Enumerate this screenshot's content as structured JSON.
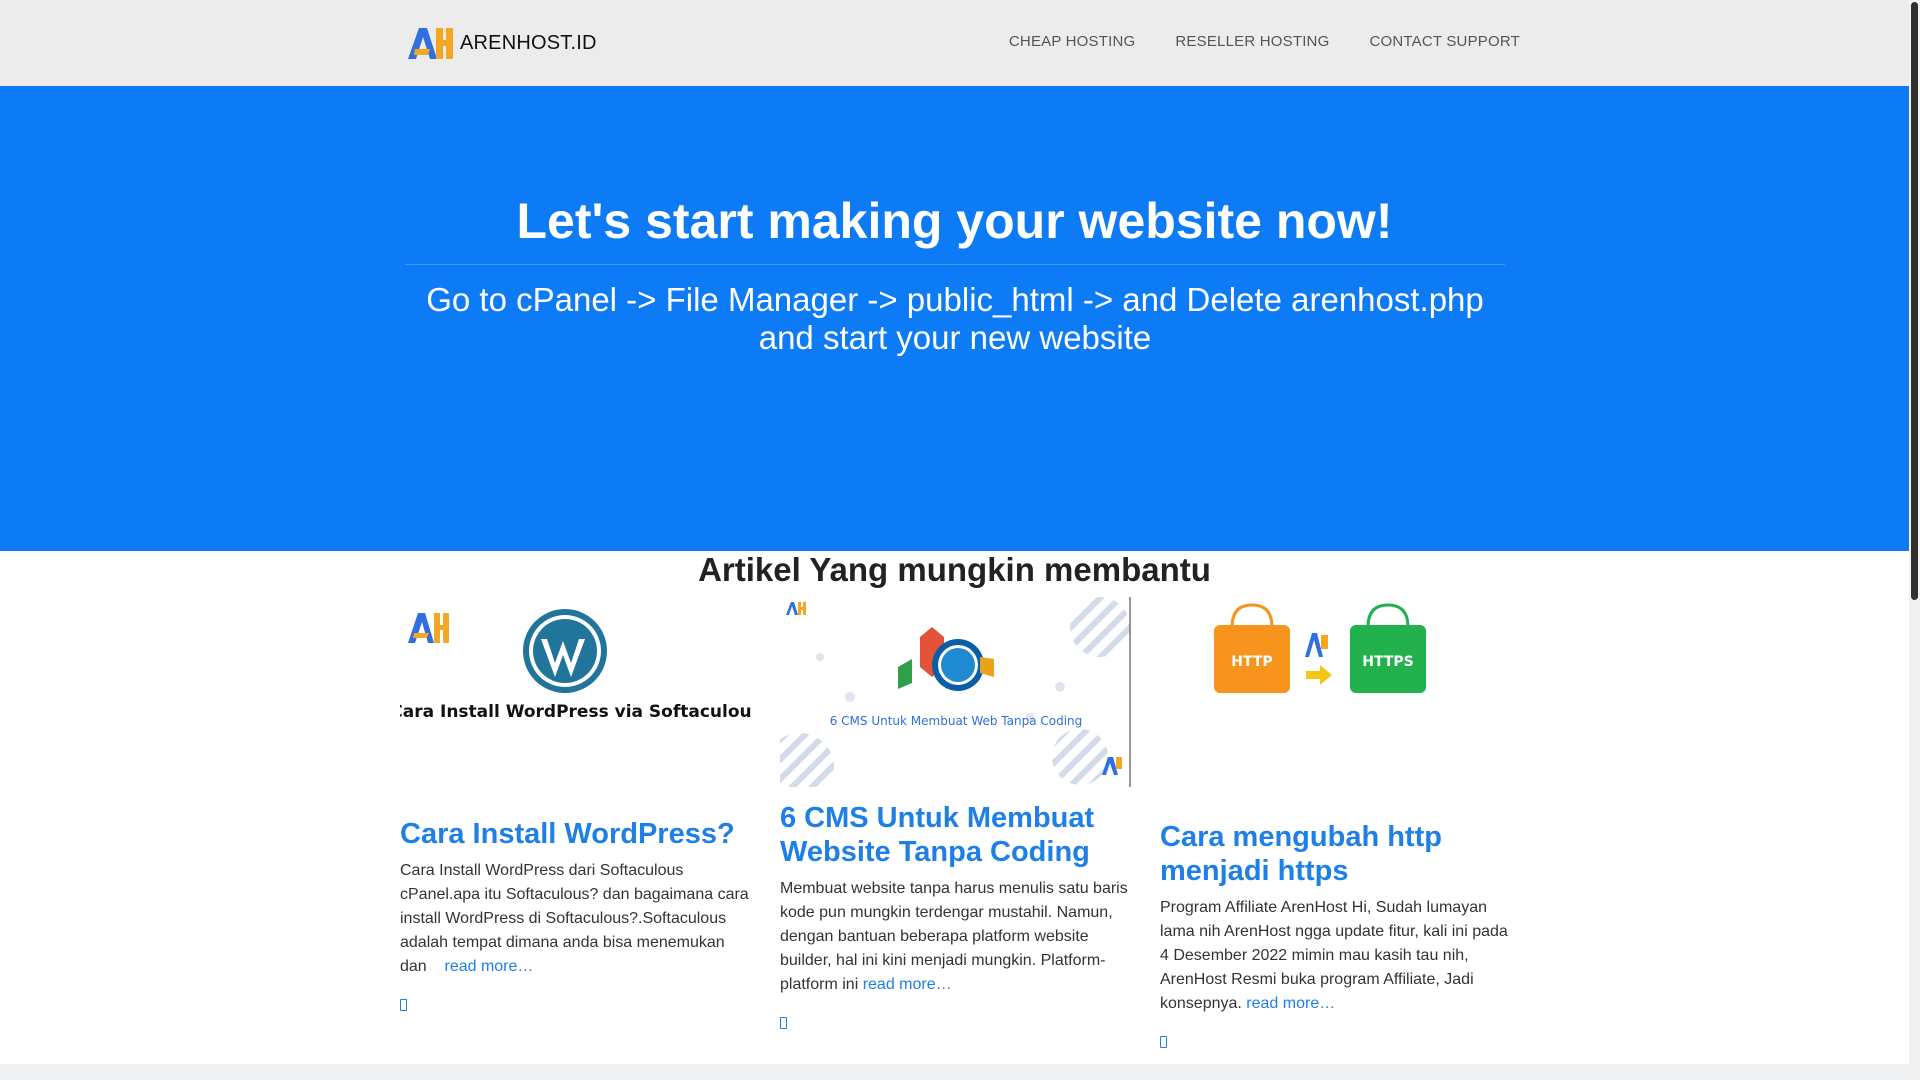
{
  "navbar": {
    "brand": "ARENHOST.ID",
    "logo_icon": "arenhost-logo-icon",
    "links": [
      {
        "label": "CHEAP HOSTING"
      },
      {
        "label": "RESELLER HOSTING"
      },
      {
        "label": "CONTACT SUPPORT"
      }
    ]
  },
  "hero": {
    "title": "Let's start making your website now!",
    "subtitle": "Go to cPanel -> File Manager -> public_html -> and Delete arenhost.php and start your new website"
  },
  "articles": {
    "heading": "Artikel Yang mungkin membantu",
    "items": [
      {
        "thumb_caption": "Cara Install WordPress via Softaculous",
        "title": "Cara Install WordPress?",
        "excerpt": "Cara Install WordPress dari Softaculous cPanel.apa itu Softaculous? dan bagaimana cara install WordPress di Softaculous?.Softaculous adalah tempat dimana anda bisa menemukan dan",
        "read_more": "read more…"
      },
      {
        "thumb_caption": "6 CMS Untuk Membuat Web Tanpa Coding",
        "title": "6 CMS Untuk Membuat Website Tanpa Coding",
        "excerpt": "Membuat website tanpa harus menulis satu baris kode pun mungkin terdengar mustahil. Namun, dengan bantuan beberapa platform website builder, hal ini kini menjadi mungkin. Platform-platform ini",
        "read_more": "read more…"
      },
      {
        "thumb_left_label": "HTTP",
        "thumb_right_label": "HTTPS",
        "title": "Cara mengubah http menjadi https",
        "excerpt": "Program Affiliate ArenHost Hi, Sudah lumayan lama nih ArenHost ngga update fitur, kali ini pada 4 Desember 2022 mimin mau kasih tau nih, ArenHost Resmi buka program Affiliate, Jadi konsepnya.",
        "read_more": "read more…"
      }
    ]
  },
  "colors": {
    "hero_bg": "#0d7bf5",
    "link": "#1e7fe6",
    "logo_orange": "#f5a623",
    "logo_blue": "#2f6fe0"
  }
}
